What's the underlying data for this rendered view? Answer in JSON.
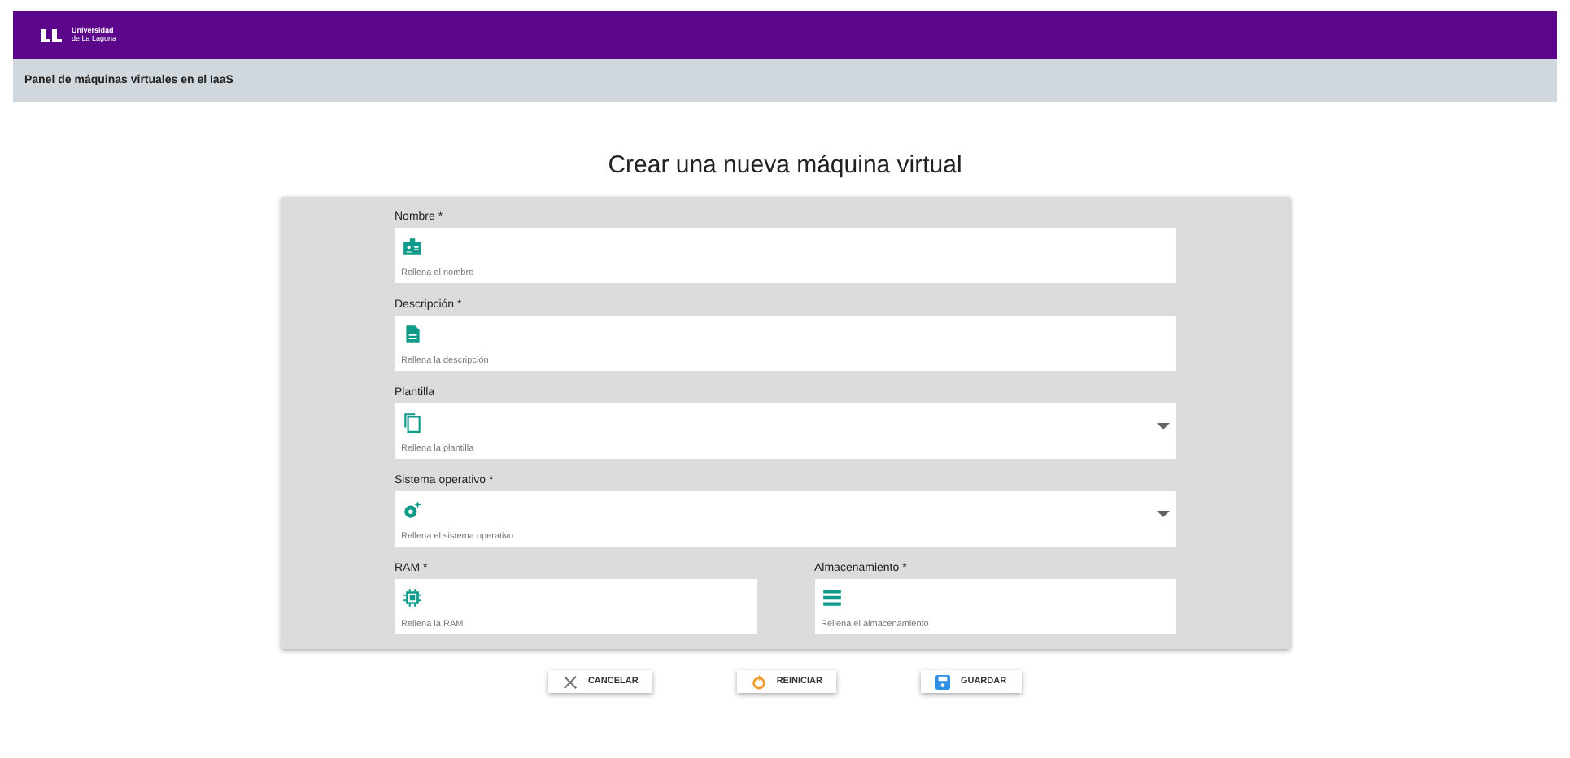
{
  "header": {
    "logo_line1": "Universidad",
    "logo_line2": "de La Laguna"
  },
  "subheader": {
    "title": "Panel de máquinas virtuales en el IaaS"
  },
  "page_title": "Crear una nueva máquina virtual",
  "form_rows": [
    [
      {
        "label": "Nombre *",
        "placeholder": "Rellena el nombre",
        "kind": "text"
      }
    ],
    [
      {
        "label": "Descripción *",
        "placeholder": "Rellena la descripción",
        "kind": "text"
      }
    ],
    [
      {
        "label": "Plantilla",
        "placeholder": "Rellena la plantilla",
        "kind": "select"
      }
    ],
    [
      {
        "label": "Sistema operativo *",
        "placeholder": "Rellena el sistema operativo",
        "kind": "select"
      }
    ],
    [
      {
        "label": "RAM *",
        "placeholder": "Rellena la RAM",
        "kind": "text"
      },
      {
        "label": "Almacenamiento *",
        "placeholder": "Rellena el almacenamiento",
        "kind": "text"
      }
    ]
  ],
  "buttons": [
    {
      "label": "CANCELAR",
      "kind": "cancel"
    },
    {
      "label": "REINICIAR",
      "kind": "reset"
    },
    {
      "label": "GUARDAR",
      "kind": "save"
    }
  ]
}
